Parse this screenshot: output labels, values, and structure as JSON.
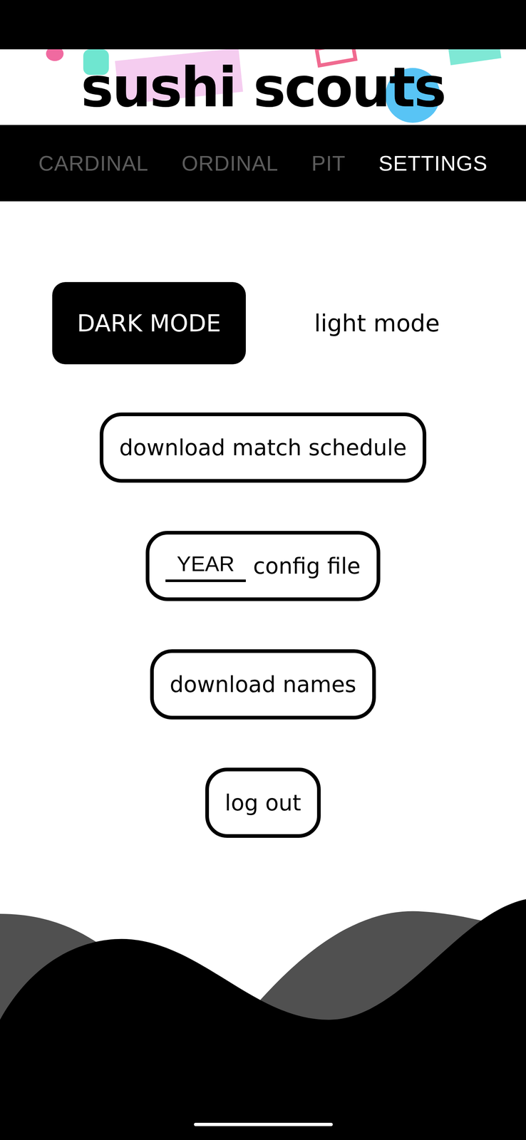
{
  "header": {
    "title": "sushi scouts"
  },
  "tabs": [
    {
      "label": "CARDINAL",
      "selected": false
    },
    {
      "label": "ORDINAL",
      "selected": false
    },
    {
      "label": "PIT",
      "selected": false
    },
    {
      "label": "SETTINGS",
      "selected": true
    }
  ],
  "mode_toggle": [
    {
      "label": "DARK MODE",
      "selected": true
    },
    {
      "label": "light mode",
      "selected": false
    }
  ],
  "actions": [
    {
      "kind": "button",
      "label": "download match schedule"
    },
    {
      "kind": "input",
      "placeholder": "YEAR",
      "label": "config file"
    },
    {
      "kind": "button",
      "label": "download names"
    },
    {
      "kind": "button",
      "label": "log out"
    }
  ]
}
